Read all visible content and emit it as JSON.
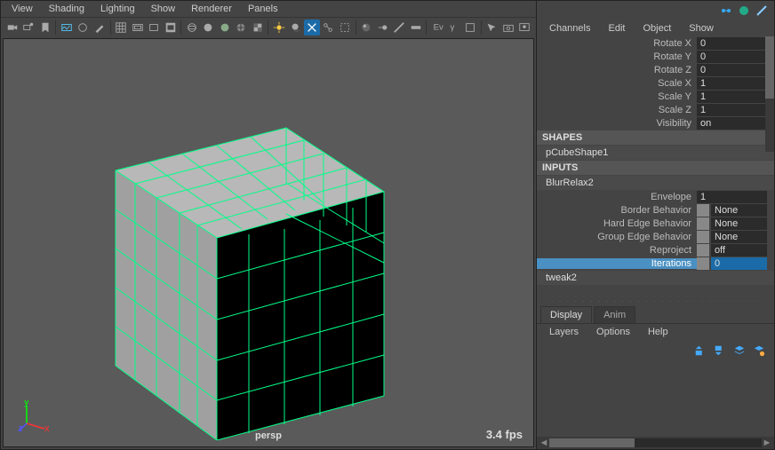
{
  "viewport": {
    "menus": [
      "View",
      "Shading",
      "Lighting",
      "Show",
      "Renderer",
      "Panels"
    ],
    "camera": "persp",
    "fps": "3.4 fps"
  },
  "channelBox": {
    "menus": [
      "Channels",
      "Edit",
      "Object",
      "Show"
    ],
    "transforms": [
      {
        "label": "Rotate X",
        "value": "0"
      },
      {
        "label": "Rotate Y",
        "value": "0"
      },
      {
        "label": "Rotate Z",
        "value": "0"
      },
      {
        "label": "Scale X",
        "value": "1"
      },
      {
        "label": "Scale Y",
        "value": "1"
      },
      {
        "label": "Scale Z",
        "value": "1"
      },
      {
        "label": "Visibility",
        "value": "on"
      }
    ],
    "shapesHeader": "SHAPES",
    "shapeName": "pCubeShape1",
    "inputsHeader": "INPUTS",
    "inputNode": "BlurRelax2",
    "inputAttrs": [
      {
        "label": "Envelope",
        "value": "1",
        "type": "num"
      },
      {
        "label": "Border Behavior",
        "value": "None",
        "type": "enum"
      },
      {
        "label": "Hard Edge Behavior",
        "value": "None",
        "type": "enum"
      },
      {
        "label": "Group Edge Behavior",
        "value": "None",
        "type": "enum"
      },
      {
        "label": "Reproject",
        "value": "off",
        "type": "enum"
      },
      {
        "label": "Iterations",
        "value": "0",
        "type": "num",
        "selected": true
      }
    ],
    "tweakNode": "tweak2"
  },
  "layerEditor": {
    "tabs": [
      "Display",
      "Anim"
    ],
    "activeTab": "Display",
    "menus": [
      "Layers",
      "Options",
      "Help"
    ]
  }
}
